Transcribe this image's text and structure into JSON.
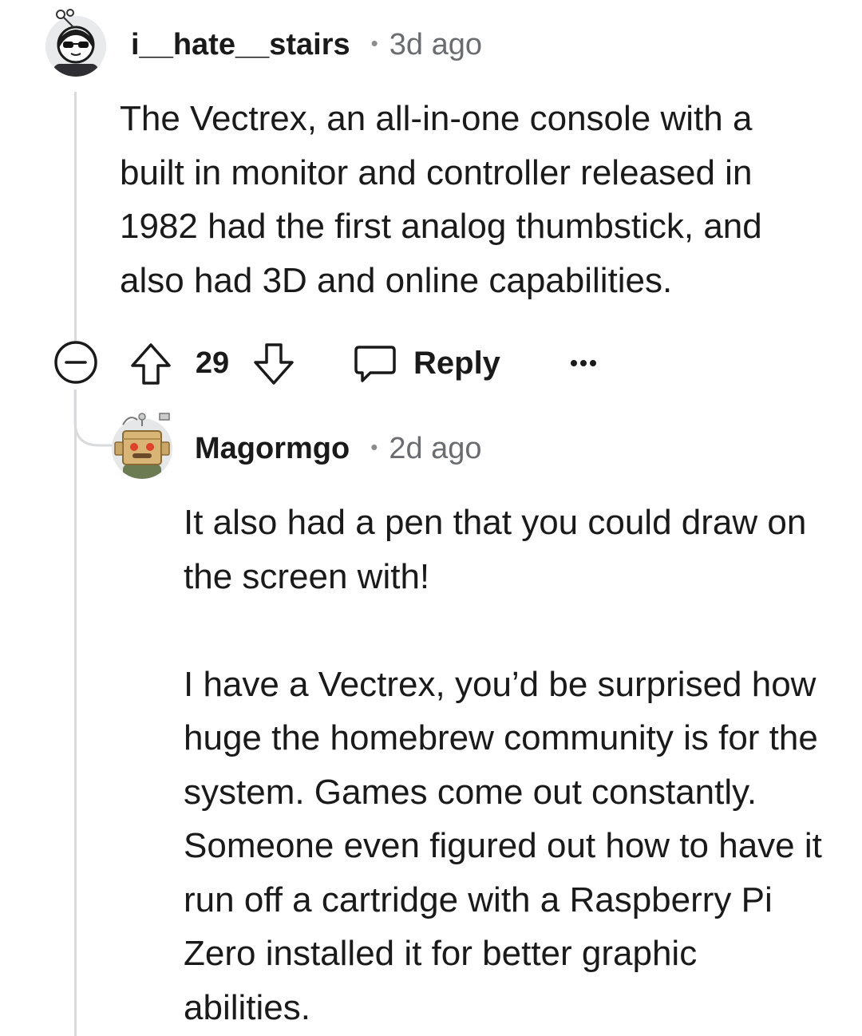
{
  "comments": [
    {
      "username": "i__hate__stairs",
      "time": "3d ago",
      "avatar": "avatar-sunglasses-icon",
      "body": [
        "The Vectrex, an all-in-one console with a built in monitor and controller released in 1982 had the first analog thumbstick, and also had 3D and online capabilities."
      ],
      "votes": "29",
      "reply_label": "Reply"
    },
    {
      "username": "Magormgo",
      "time": "2d ago",
      "avatar": "avatar-cardboard-robot-icon",
      "body": [
        "It also had a pen that you could draw on the screen with!",
        "I have a Vectrex, you’d be surprised how huge the homebrew community is for the system. Games come out constantly. Someone even figured out how to have it run off a cartridge with a Raspberry Pi Zero installed it for better graphic abilities."
      ]
    }
  ],
  "icons": {
    "collapse": "collapse-minus-icon",
    "upvote": "upvote-arrow-icon",
    "downvote": "downvote-arrow-icon",
    "reply": "speech-bubble-icon",
    "more": "more-options-icon"
  },
  "colors": {
    "text": "#1a1a1b",
    "meta": "#6a6c6f",
    "thread_line": "#d9dadc"
  }
}
